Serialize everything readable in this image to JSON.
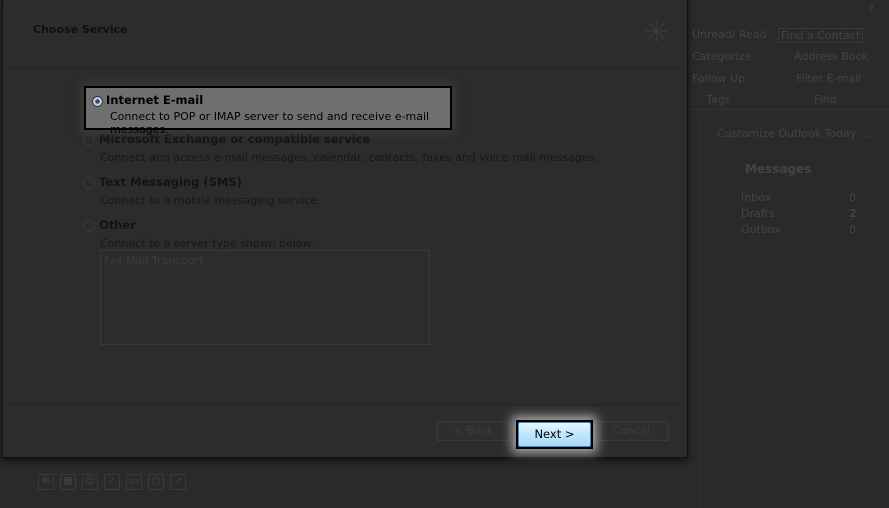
{
  "ribbon": {
    "unread_read": "Unread/ Read",
    "categorize": "Categorize",
    "follow_up": "Follow Up",
    "tags_group": "Tags",
    "find_contact": "Find a Contact",
    "address_book": "Address Book",
    "filter_email": "Filter E-mail",
    "find_group": "Find"
  },
  "today": {
    "customize": "Customize Outlook Today ...",
    "messages_title": "Messages",
    "rows": [
      {
        "label": "Inbox",
        "count": "0"
      },
      {
        "label": "Drafts",
        "count": "2"
      },
      {
        "label": "Outbox",
        "count": "0"
      }
    ]
  },
  "dialog": {
    "title": "Choose Service",
    "options": [
      {
        "label": "Internet E-mail",
        "desc": "Connect to POP or IMAP server to send and receive e-mail messages.",
        "selected": true
      },
      {
        "label": "Microsoft Exchange or compatible service",
        "desc": "Connect and access e-mail messages, calendar, contacts, faxes and voice mail messages."
      },
      {
        "label": "Text Messaging (SMS)",
        "desc": "Connect to a mobile messaging service."
      },
      {
        "label": "Other",
        "desc": "Connect to a server type shown below."
      }
    ],
    "server_types": [
      "Fax Mail Transport"
    ],
    "back": "< Back",
    "next": "Next >",
    "cancel": "Cancel"
  },
  "colors": {
    "next_button": "#bee6fd",
    "highlight": "#6f6f6f"
  }
}
